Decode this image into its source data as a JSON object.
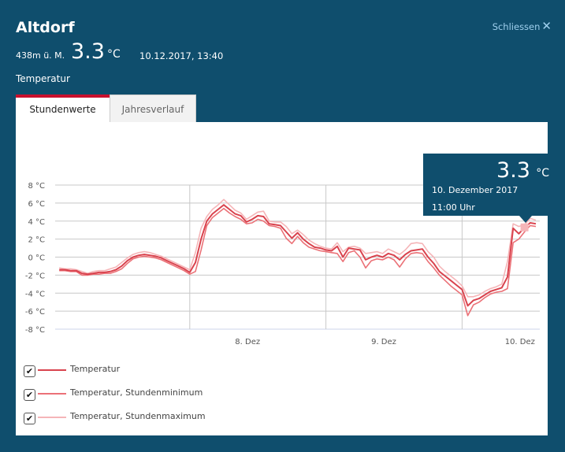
{
  "header": {
    "station": "Altdorf",
    "altitude": "438m ü. M.",
    "current_value": "3.3",
    "unit": "°C",
    "timestamp": "10.12.2017, 13:40",
    "parameter": "Temperatur",
    "close_label": "Schliessen",
    "close_icon": "close-icon"
  },
  "tabs": [
    {
      "label": "Stundenwerte",
      "active": true
    },
    {
      "label": "Jahresverlauf",
      "active": false
    }
  ],
  "tooltip": {
    "value": "3.3",
    "unit": "°C",
    "date": "10. Dezember 2017",
    "time": "11:00 Uhr"
  },
  "legend": [
    {
      "label": "Temperatur",
      "checked": true,
      "color": "#d9434e"
    },
    {
      "label": "Temperatur, Stundenminimum",
      "checked": true,
      "color": "#eb7177"
    },
    {
      "label": "Temperatur, Stundenmaximum",
      "checked": true,
      "color": "#f5b5b8"
    }
  ],
  "chart_data": {
    "type": "line",
    "x_unit": "hours since 7. Dez 00:00",
    "x_start_hour": 1,
    "x_range_hours": [
      0,
      86
    ],
    "ylim": [
      -8,
      8
    ],
    "yticks": [
      8,
      6,
      4,
      2,
      0,
      -2,
      -4,
      -6,
      -8
    ],
    "ytick_labels": [
      "8 °C",
      "6 °C",
      "4 °C",
      "2 °C",
      "0 °C",
      "-2 °C",
      "-4 °C",
      "-6 °C",
      "-8 °C"
    ],
    "xticks": [
      {
        "label": "8. Dez",
        "hour": 36
      },
      {
        "label": "9. Dez",
        "hour": 60
      },
      {
        "label": "10. Dez",
        "hour": 84
      }
    ],
    "day_gridlines_hours": [
      24,
      48,
      72
    ],
    "highlight": {
      "series": 0,
      "hour": 83,
      "value": 3.3
    },
    "series": [
      {
        "name": "Temperatur",
        "values": [
          -1.4,
          -1.4,
          -1.5,
          -1.5,
          -1.8,
          -1.9,
          -1.8,
          -1.7,
          -1.7,
          -1.6,
          -1.4,
          -1.0,
          -0.4,
          0.0,
          0.2,
          0.3,
          0.2,
          0.1,
          -0.1,
          -0.4,
          -0.7,
          -1.0,
          -1.3,
          -1.7,
          -0.6,
          2.0,
          4.0,
          4.8,
          5.3,
          5.8,
          5.3,
          4.8,
          4.6,
          3.9,
          4.2,
          4.6,
          4.5,
          3.7,
          3.6,
          3.5,
          2.8,
          2.1,
          2.7,
          2.0,
          1.5,
          1.1,
          1.0,
          0.8,
          0.7,
          1.2,
          0.0,
          1.0,
          0.9,
          0.8,
          -0.3,
          0.0,
          0.2,
          0.0,
          0.4,
          0.2,
          -0.3,
          0.3,
          0.7,
          0.8,
          0.9,
          0.0,
          -0.7,
          -1.6,
          -2.1,
          -2.6,
          -3.1,
          -3.6,
          -5.4,
          -4.8,
          -4.6,
          -4.2,
          -3.8,
          -3.6,
          -3.4,
          -2.2,
          3.2,
          2.6,
          3.3,
          3.8,
          3.7
        ]
      },
      {
        "name": "Temperatur, Stundenminimum",
        "values": [
          -1.5,
          -1.5,
          -1.6,
          -1.6,
          -2.0,
          -2.0,
          -1.9,
          -1.9,
          -1.8,
          -1.8,
          -1.6,
          -1.3,
          -0.7,
          -0.2,
          0.0,
          0.1,
          0.0,
          -0.1,
          -0.3,
          -0.6,
          -0.9,
          -1.2,
          -1.5,
          -1.9,
          -1.6,
          0.8,
          3.5,
          4.4,
          4.9,
          5.4,
          4.9,
          4.5,
          4.2,
          3.7,
          3.8,
          4.2,
          4.0,
          3.5,
          3.4,
          3.2,
          2.1,
          1.5,
          2.3,
          1.6,
          1.1,
          0.9,
          0.7,
          0.6,
          0.5,
          0.4,
          -0.5,
          0.5,
          0.7,
          0.0,
          -1.2,
          -0.4,
          -0.2,
          -0.3,
          0.0,
          -0.3,
          -1.1,
          -0.2,
          0.4,
          0.5,
          0.4,
          -0.5,
          -1.2,
          -2.0,
          -2.6,
          -3.2,
          -3.7,
          -4.2,
          -6.5,
          -5.3,
          -5.0,
          -4.5,
          -4.1,
          -3.9,
          -3.8,
          -3.5,
          1.6,
          2.0,
          2.8,
          3.5,
          3.4
        ]
      },
      {
        "name": "Temperatur, Stundenmaximum",
        "values": [
          -1.2,
          -1.3,
          -1.3,
          -1.4,
          -1.6,
          -1.8,
          -1.6,
          -1.5,
          -1.5,
          -1.3,
          -1.1,
          -0.6,
          -0.1,
          0.3,
          0.5,
          0.6,
          0.5,
          0.3,
          0.1,
          -0.2,
          -0.5,
          -0.8,
          -1.1,
          -1.4,
          0.5,
          3.2,
          4.5,
          5.3,
          5.8,
          6.4,
          5.8,
          5.2,
          4.9,
          4.2,
          4.6,
          5.0,
          5.1,
          4.0,
          3.9,
          3.9,
          3.4,
          2.6,
          3.0,
          2.5,
          1.9,
          1.5,
          1.2,
          1.0,
          0.9,
          1.6,
          0.6,
          1.1,
          1.2,
          1.0,
          0.4,
          0.5,
          0.6,
          0.4,
          0.9,
          0.6,
          0.3,
          0.8,
          1.5,
          1.6,
          1.5,
          0.6,
          0.0,
          -1.0,
          -1.6,
          -2.1,
          -2.6,
          -3.2,
          -4.4,
          -4.4,
          -4.2,
          -3.8,
          -3.5,
          -3.3,
          -3.0,
          -0.5,
          3.7,
          3.4,
          3.6,
          4.3,
          4.1
        ]
      }
    ]
  }
}
